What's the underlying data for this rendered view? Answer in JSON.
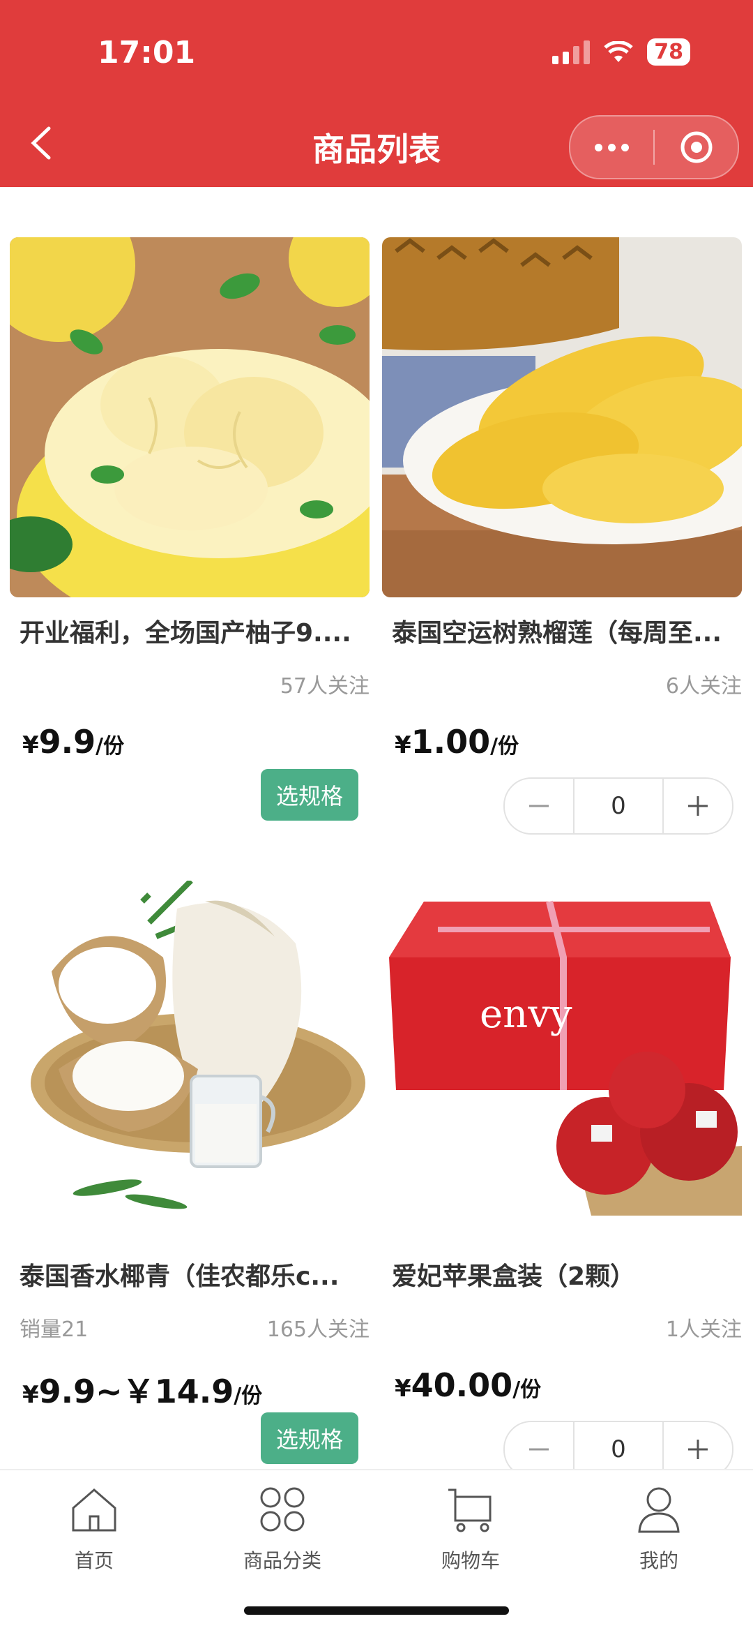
{
  "status_bar": {
    "time": "17:01",
    "battery": "78"
  },
  "header": {
    "title": "商品列表"
  },
  "products": [
    {
      "name": "开业福利，全场国产柚子9....",
      "sales": "",
      "followers": "57人关注",
      "price_yen": "¥",
      "price": "9.9",
      "price_unit": "/份",
      "action": "选规格"
    },
    {
      "name": "泰国空运树熟榴莲（每周至...",
      "sales": "",
      "followers": "6人关注",
      "price_yen": "¥",
      "price": "1.00",
      "price_unit": "/份",
      "quantity": "0"
    },
    {
      "name": "泰国香水椰青（佳农都乐c...",
      "sales": "销量21",
      "followers": "165人关注",
      "price_yen": "¥",
      "price": "9.9~￥14.9",
      "price_unit": "/份",
      "action": "选规格"
    },
    {
      "name": "爱妃苹果盒装（2颗）",
      "sales": "",
      "followers": "1人关注",
      "price_yen": "¥",
      "price": "40.00",
      "price_unit": "/份",
      "quantity": "0"
    }
  ],
  "product_image_text": {
    "brand": "envy"
  },
  "bottom_nav": [
    {
      "label": "首页",
      "icon": "home-icon"
    },
    {
      "label": "商品分类",
      "icon": "category-icon"
    },
    {
      "label": "购物车",
      "icon": "cart-icon"
    },
    {
      "label": "我的",
      "icon": "user-icon"
    }
  ],
  "colors": {
    "header": "#e03c3c",
    "spec_button": "#4caf88"
  }
}
